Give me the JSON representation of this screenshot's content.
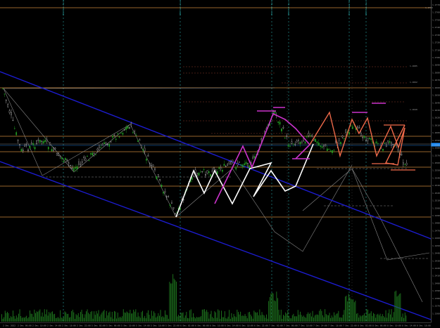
{
  "window": {
    "theme_background": "#000000",
    "axis_color": "#6e6e6e"
  },
  "price_axis": {
    "labels": [
      "1.2770",
      "1.2760",
      "1.2750",
      "1.2740",
      "1.2730",
      "1.2720",
      "1.2710",
      "1.2700",
      "1.2690",
      "1.2680",
      "1.2670",
      "1.2660",
      "1.2650",
      "1.2640",
      "1.2630",
      "1.2620",
      "1.2610",
      "1.2600",
      "1.2590",
      "1.2580",
      "1.2570",
      "1.2560",
      "1.2550",
      "1.2540",
      "1.2530",
      "1.2520",
      "1.2510",
      "1.2500",
      "1.2490",
      "1.2480",
      "1.2470",
      "1.2460",
      "1.2450",
      "1.2440",
      "1.2430",
      "1.2420",
      "1.2410",
      "1.2400",
      "1.2390",
      "1.2380",
      "1.2370",
      "1.2360"
    ],
    "current_price_label": "1.2608",
    "current_price_color": "#1e90ff"
  },
  "time_axis": {
    "labels": [
      "2 Dec 2022",
      "2 Dec 06:00",
      "2 Dec 10:00",
      "2 Dec 14:00",
      "2 Dec 18:00",
      "2 Dec 22:00",
      "5 Dec 02:00",
      "5 Dec 06:00",
      "5 Dec 10:00",
      "5 Dec 14:00",
      "5 Dec 18:00",
      "5 Dec 22:00",
      "6 Dec 02:00",
      "6 Dec 06:00",
      "6 Dec 10:00",
      "6 Dec 14:00",
      "6 Dec 18:00",
      "6 Dec 22:00",
      "7 Dec 02:00",
      "7 Dec 06:00",
      "7 Dec 10:00",
      "7 Dec 14:00",
      "7 Dec 18:00",
      "7 Dec 22:00",
      "8 Dec 02:00",
      "8 Dec 06:00",
      "8 Dec 10:00",
      "8 Dec 14:00",
      "8 Dec 18:00"
    ]
  },
  "level_labels": {
    "top": "1.2750",
    "upper_right": [
      "1.2685",
      "1.2662",
      "1.2649"
    ],
    "channel_right": "1.2625"
  },
  "vertical_marker_labels": [
    "USD Non-Farm Employment",
    "GBP Services PMI",
    "USD ISM Services",
    "GBP BoE Gov Speaks",
    "USD Trade Balance",
    "GBP Halifax HPI"
  ],
  "colors": {
    "channel": "#1c1cd0",
    "level": "#c8873a",
    "zigzag_white": "#ffffff",
    "zigzag_magenta": "#cc33cc",
    "zigzag_salmon": "#f06a4a",
    "projection": "#8a8a8a",
    "vmarker": "#2aa8a8",
    "volume": "#1f7a1f",
    "candle_up": "#22a022",
    "candle_down": "#d8d8d8"
  }
}
